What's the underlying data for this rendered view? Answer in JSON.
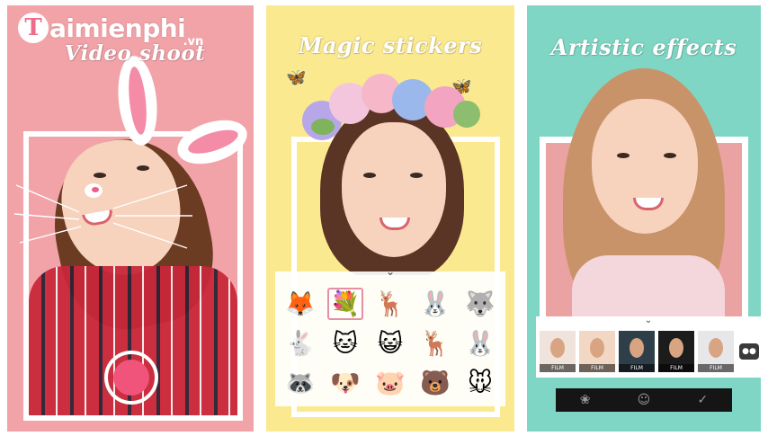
{
  "watermark": {
    "mark": "T",
    "text": "aimienphi",
    "domain": ".vn"
  },
  "panels": [
    {
      "title": "Video shoot"
    },
    {
      "title": "Magic stickers"
    },
    {
      "title": "Artistic effects"
    }
  ],
  "colors": {
    "panel1_bg": "#f2a3a8",
    "panel2_bg": "#fbe98f",
    "panel3_bg": "#7fd6c4",
    "shutter_accent": "#f1547a"
  },
  "stickers": [
    {
      "icon": "fox-face-icon",
      "glyph": "🦊"
    },
    {
      "icon": "flower-crown-icon",
      "glyph": "💐"
    },
    {
      "icon": "deer-antlers-icon",
      "glyph": "🦌"
    },
    {
      "icon": "bunny-ears-icon",
      "glyph": "🐰"
    },
    {
      "icon": "husky-face-icon",
      "glyph": "🐺"
    },
    {
      "icon": "white-bunny-icon",
      "glyph": "🐇"
    },
    {
      "icon": "white-cat-icon",
      "glyph": "🐱"
    },
    {
      "icon": "pink-cat-icon",
      "glyph": "😺"
    },
    {
      "icon": "reindeer-icon",
      "glyph": "🦌"
    },
    {
      "icon": "pink-bunny-icon",
      "glyph": "🐰"
    },
    {
      "icon": "red-panda-icon",
      "glyph": "🦝"
    },
    {
      "icon": "dalmatian-icon",
      "glyph": "🐶"
    },
    {
      "icon": "piglet-icon",
      "glyph": "🐷"
    },
    {
      "icon": "pink-bear-icon",
      "glyph": "🐻"
    },
    {
      "icon": "mouse-face-icon",
      "glyph": "🐭"
    }
  ],
  "selected_sticker_index": 1,
  "filters": [
    {
      "label": "FILM"
    },
    {
      "label": "FILM"
    },
    {
      "label": "FILM"
    },
    {
      "label": "FILM"
    },
    {
      "label": "FILM"
    }
  ],
  "filter_more_label": "●●",
  "toolbar": [
    {
      "icon": "filter-circles-icon",
      "glyph": "❀"
    },
    {
      "icon": "smile-face-icon",
      "glyph": "☺"
    },
    {
      "icon": "check-circle-icon",
      "glyph": "✓"
    }
  ]
}
